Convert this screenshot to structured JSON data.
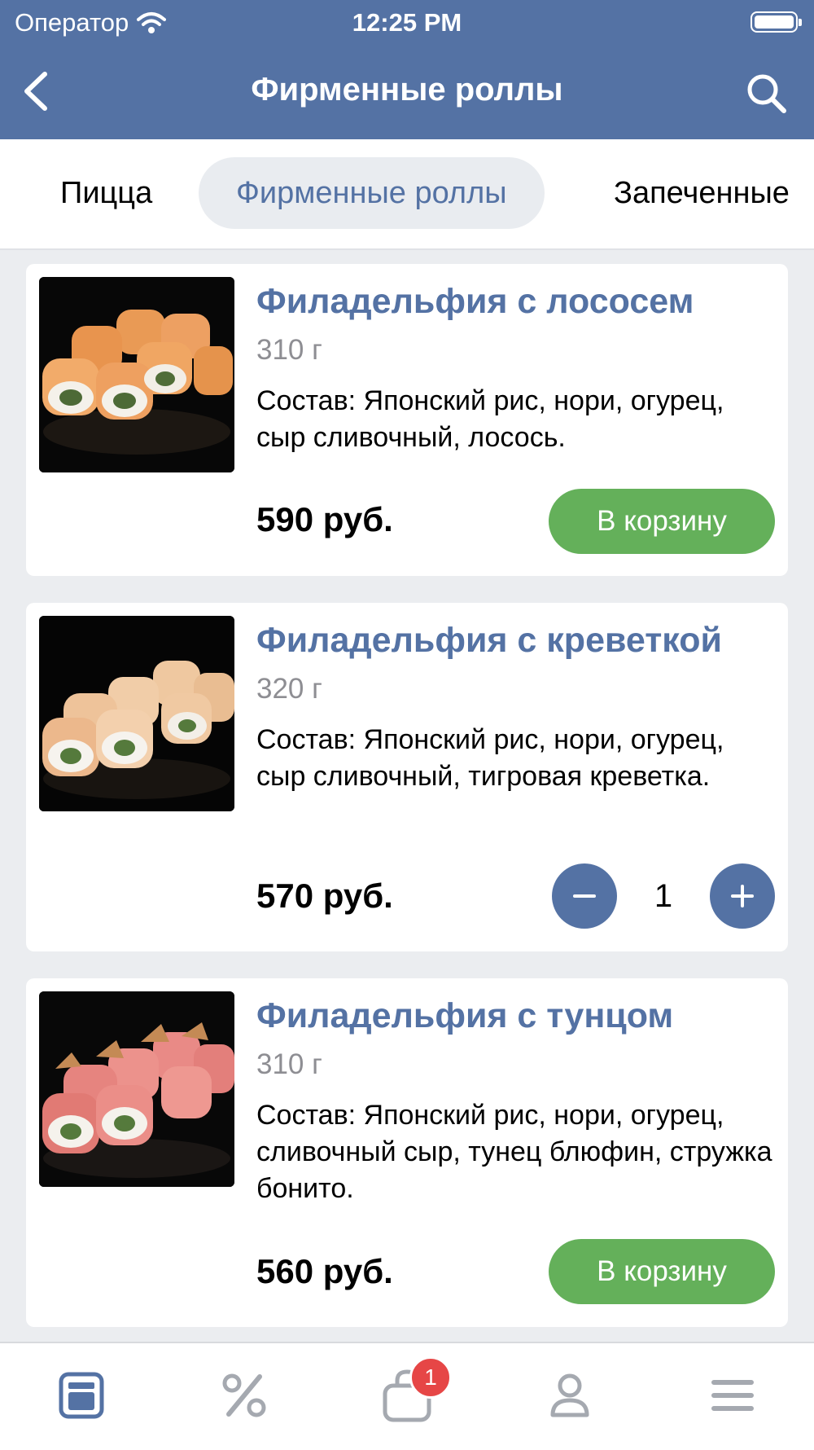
{
  "status_bar": {
    "carrier": "Оператор",
    "time": "12:25 PM"
  },
  "nav": {
    "title": "Фирменные роллы",
    "back_icon": "chevron-left-icon",
    "search_icon": "search-icon"
  },
  "tabs": [
    {
      "label": "Пицца",
      "active": false
    },
    {
      "label": "Фирменные роллы",
      "active": true
    },
    {
      "label": "Запеченные",
      "active": false
    }
  ],
  "products": [
    {
      "title": "Филадельфия с лососем",
      "weight": "310 г",
      "description": "Состав: Японский рис, нори, огурец, сыр сливочный, лосось.",
      "price": "590 руб.",
      "cart_label": "В корзину"
    },
    {
      "title": "Филадельфия с креветкой",
      "weight": "320 г",
      "description": "Состав: Японский рис, нори, огурец, сыр сливочный, тигровая креветка.",
      "price": "570 руб.",
      "quantity": "1"
    },
    {
      "title": "Филадельфия с тунцом",
      "weight": "310 г",
      "description": "Состав: Японский рис, нори, огурец, сливочный сыр, тунец блюфин, стружка бонито.",
      "price": "560 руб.",
      "cart_label": "В корзину"
    }
  ],
  "bottom_nav": {
    "items": [
      "menu-card-icon",
      "percent-icon",
      "cart-icon",
      "profile-icon",
      "hamburger-menu-icon"
    ],
    "cart_badge": "1"
  },
  "colors": {
    "accent": "#5472a4",
    "cart_button": "#64b05a",
    "badge": "#e64646",
    "background": "#ebedf0"
  }
}
